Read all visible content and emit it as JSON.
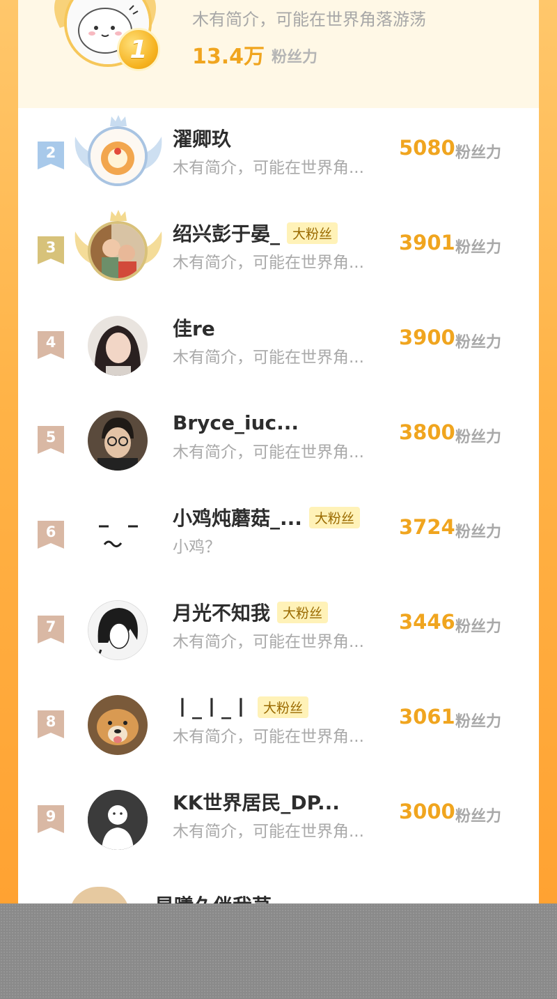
{
  "top": {
    "rank": "1",
    "desc": "木有简介，可能在世界角落游荡",
    "score": "13.4万",
    "score_label": "粉丝力"
  },
  "rows": [
    {
      "rank": "2",
      "name": "濯卿玖",
      "badge": "",
      "desc": "木有简介，可能在世界角...",
      "score": "5080",
      "score_label": "粉丝力",
      "flag_color": "#a8c9ea"
    },
    {
      "rank": "3",
      "name": "绍兴彭于晏_",
      "badge": "大粉丝",
      "desc": "木有简介，可能在世界角...",
      "score": "3901",
      "score_label": "粉丝力",
      "flag_color": "#d7c27a"
    },
    {
      "rank": "4",
      "name": "佳re",
      "badge": "",
      "desc": "木有简介，可能在世界角...",
      "score": "3900",
      "score_label": "粉丝力",
      "flag_color": "#d9b8a4"
    },
    {
      "rank": "5",
      "name": "Bryce_iuc...",
      "badge": "",
      "desc": "木有简介，可能在世界角...",
      "score": "3800",
      "score_label": "粉丝力",
      "flag_color": "#d9b8a4"
    },
    {
      "rank": "6",
      "name": "小鸡炖蘑菇_...",
      "badge": "大粉丝",
      "desc": "小鸡？",
      "score": "3724",
      "score_label": "粉丝力",
      "flag_color": "#d9b8a4"
    },
    {
      "rank": "7",
      "name": "月光不知我",
      "badge": "大粉丝",
      "desc": "木有简介，可能在世界角...",
      "score": "3446",
      "score_label": "粉丝力",
      "flag_color": "#d9b8a4"
    },
    {
      "rank": "8",
      "name": "丨_丨_丨",
      "badge": "大粉丝",
      "desc": "木有简介，可能在世界角...",
      "score": "3061",
      "score_label": "粉丝力",
      "flag_color": "#d9b8a4"
    },
    {
      "rank": "9",
      "name": "KK世界居民_DP...",
      "badge": "",
      "desc": "木有简介，可能在世界角...",
      "score": "3000",
      "score_label": "粉丝力",
      "flag_color": "#d9b8a4"
    }
  ],
  "peek": {
    "name": "星曦久伴我荨"
  }
}
